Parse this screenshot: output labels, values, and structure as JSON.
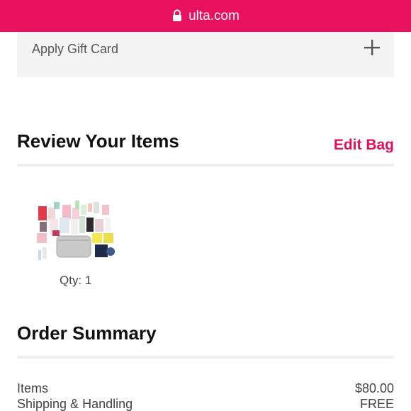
{
  "browser": {
    "url": "ulta.com"
  },
  "gift_card": {
    "label": "Apply Gift Card"
  },
  "review": {
    "title": "Review Your Items",
    "edit_label": "Edit Bag",
    "items": [
      {
        "qty_text": "Qty: 1"
      }
    ]
  },
  "summary": {
    "title": "Order Summary",
    "rows": [
      {
        "label": "Items",
        "value": "$80.00"
      },
      {
        "label": "Shipping & Handling",
        "value": "FREE"
      }
    ]
  },
  "colors": {
    "brand": "#e8115e",
    "accent_text": "#e0115f",
    "panel": "#f4f4f4"
  }
}
